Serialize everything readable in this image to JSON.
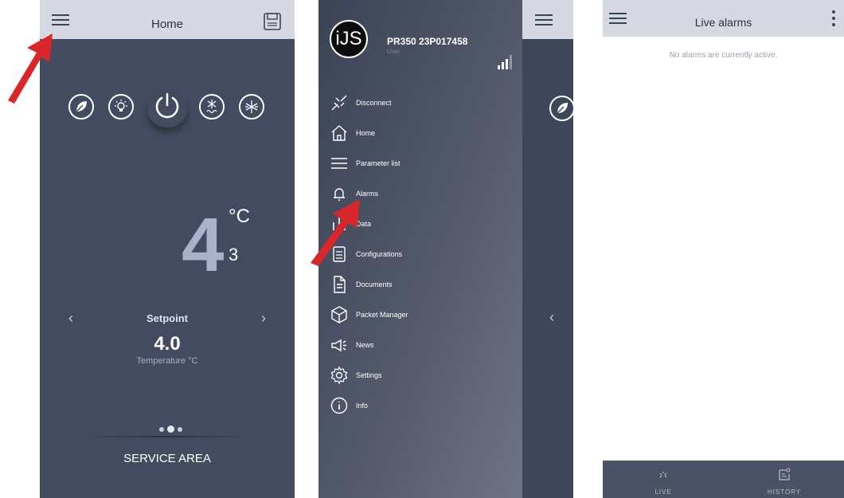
{
  "colors": {
    "panel_dark": "#424b5f",
    "topbar": "#d6d9e2",
    "accent_arrow": "#d8262a",
    "temp_digit": "#a9b2cb"
  },
  "home_screen": {
    "title": "Home",
    "menu_icon": "hamburger-icon",
    "save_icon": "floppy-disk-icon",
    "mode_icons": [
      "leaf-icon",
      "light-icon",
      "power-icon",
      "defrost-icon",
      "fan-icon"
    ],
    "temperature": {
      "integer": "4",
      "decimal": "3",
      "unit": "°C"
    },
    "setpoint": {
      "prev_arrow": "‹",
      "next_arrow": "›",
      "label": "Setpoint",
      "value": "4.0",
      "sub_label": "Temperature °C"
    },
    "pager": {
      "count": 3,
      "active_index": 1
    },
    "service_area_label": "SERVICE AREA"
  },
  "nav_drawer": {
    "logo_text": "iJS",
    "device_name": "PR350 23P017458",
    "user_label": "User",
    "signal_icon": "signal-strength-icon",
    "items": [
      {
        "label": "Disconnect",
        "icon": "disconnect-icon"
      },
      {
        "label": "Home",
        "icon": "home-icon"
      },
      {
        "label": "Parameter list",
        "icon": "list-icon"
      },
      {
        "label": "Alarms",
        "icon": "bell-icon"
      },
      {
        "label": "Data",
        "icon": "data-icon"
      },
      {
        "label": "Configurations",
        "icon": "configurations-icon"
      },
      {
        "label": "Documents",
        "icon": "document-icon"
      },
      {
        "label": "Packet Manager",
        "icon": "package-icon"
      },
      {
        "label": "News",
        "icon": "megaphone-icon"
      },
      {
        "label": "Settings",
        "icon": "gear-icon"
      },
      {
        "label": "Info",
        "icon": "info-icon"
      }
    ],
    "peek_arrow": "‹"
  },
  "alarms_screen": {
    "title": "Live alarms",
    "overflow_icon": "kebab-menu-icon",
    "empty_message": "No alarms are currently active.",
    "tabs": [
      {
        "label": "LIVE",
        "icon": "live-alarm-icon"
      },
      {
        "label": "HISTORY",
        "icon": "history-icon"
      }
    ]
  }
}
